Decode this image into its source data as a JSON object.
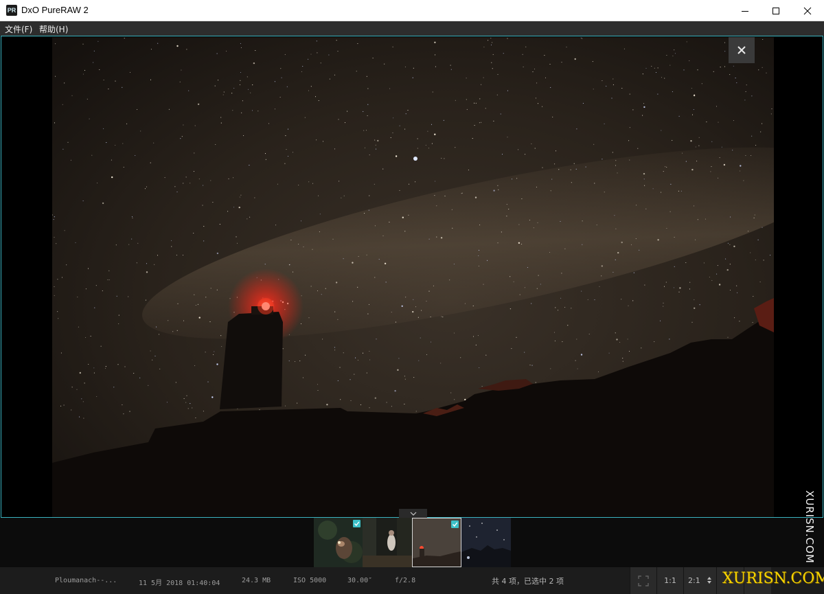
{
  "window": {
    "app_icon_text": "PR",
    "title": "DxO PureRAW 2"
  },
  "menu": {
    "items": [
      {
        "label": "文件(F)"
      },
      {
        "label": "帮助(H)"
      }
    ]
  },
  "viewer": {
    "close_icon": "close-icon",
    "collapse_icon": "chevron-down-icon"
  },
  "filmstrip": {
    "thumbnails": [
      {
        "checked": true,
        "selected": false,
        "subject": "owl at night"
      },
      {
        "checked": false,
        "selected": false,
        "subject": "person in woods"
      },
      {
        "checked": true,
        "selected": true,
        "subject": "lighthouse under milky way"
      },
      {
        "checked": false,
        "selected": false,
        "subject": "night sky over rocks"
      }
    ]
  },
  "status": {
    "filename": "Ploumanach--...",
    "date": "11 5月 2018 01:40:04",
    "size": "24.3 MB",
    "iso": "ISO 5000",
    "shutter": "30.00″",
    "aperture": "f/2.8",
    "count": "共 4 项，已选中 2 项"
  },
  "toolbar": {
    "fit_icon": "fit-screen-icon",
    "zoom_1_1": "1:1",
    "zoom_2_1": "2:1"
  },
  "watermark": {
    "vertical": "XURISN.COM",
    "logo": "XURISN.COM"
  },
  "colors": {
    "accent": "#3bb4c1",
    "check": "#3cc0c9",
    "logo": "#f5d400"
  }
}
